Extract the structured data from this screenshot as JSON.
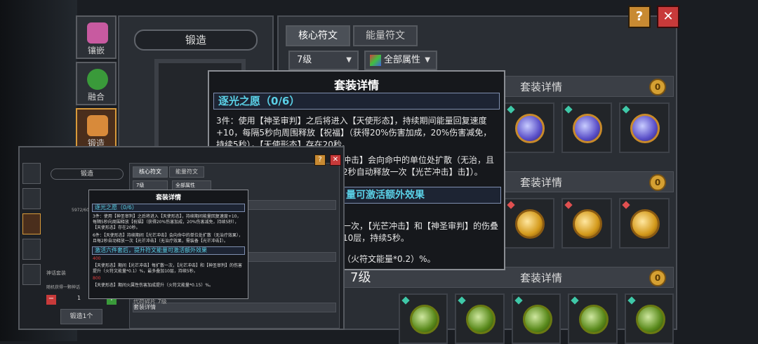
{
  "left_tabs": [
    {
      "label": "镶嵌",
      "active": false
    },
    {
      "label": "融合",
      "active": false
    },
    {
      "label": "锻造",
      "active": true
    }
  ],
  "forge": {
    "title": "锻造"
  },
  "main": {
    "tabs": [
      {
        "label": "核心符文",
        "active": true
      },
      {
        "label": "能量符文",
        "active": false
      }
    ],
    "level_filter": "7级",
    "attr_filter": "全部属性",
    "help_label": "?",
    "close_label": "✕",
    "rows": [
      {
        "label": "套装详情",
        "level": ""
      },
      {
        "label": "套装详情",
        "level": ""
      },
      {
        "label": "套装详情",
        "level": "7级"
      }
    ],
    "coin_label": "0"
  },
  "popup": {
    "title": "套装详情",
    "set_name": "逐光之愿（0/6）",
    "three_piece": "3件：使用【神圣审判】之后将进入【天使形态】，持续期间能量回复速度+10，每隔5秒向周围释放【祝福】（获得20%伤害加成，20%伤害减免，持续5秒），【天使形态】存在20秒。",
    "six_piece_partial": "芒冲击】会向命中的单位处扩散（无治，且每2秒自动释放一次【光芒冲击】击】）。",
    "sub_title": "量可激活额外效果",
    "sub_text": "散一次，【光芒冲击】和【神圣审判】的伤叠加10层，持续5秒。",
    "bottom_text": "升（火符文能量*0.2）%。"
  },
  "mini": {
    "forge_title": "锻造",
    "tabs": [
      "核心符文",
      "能量符文"
    ],
    "level_filter": "7级",
    "attr_filter": "全部属性",
    "row_label": "套装详情",
    "bottom_button": "锻造1个",
    "level7": "代符碎片 7级",
    "fraction": "5972/6000",
    "sk_label": "神话套装",
    "gen_label": "随机获得一颗神话",
    "qty": "1",
    "help_label": "?",
    "close_label": "✕",
    "popup": {
      "title": "套装详情",
      "set_name": "逐光之愿（0/6）",
      "three_piece": "3件：使用【神圣审判】之后将进入【天使形态】，持续期间能量回复速度+10，每隔5秒向周围释放【祝福】（获得20%伤害加成，20%伤害减免，持续5秒），【天使形态】存在20秒。",
      "six_piece": "6件：【天使形态】持续期间【光芒冲击】会向命中的单位处扩散（无治疗效果），且每2秒自动释放一次【光芒冲击】（无治疗效果，需装备【光芒冲击】）。",
      "extra_title": "激活六件套后，提升符文能量可激活额外效果",
      "req1": "400",
      "extra1": "【天使形态】期间【光芒冲击】每扩散一次，【光芒冲击】和【神圣审判】的伤害提升（火符文能量*0.1）%，最多叠加10层，持续5秒。",
      "req2": "800",
      "extra2": "【天使形态】期间火属性伤害加成提升（火符文能量*0.15）%。"
    }
  }
}
